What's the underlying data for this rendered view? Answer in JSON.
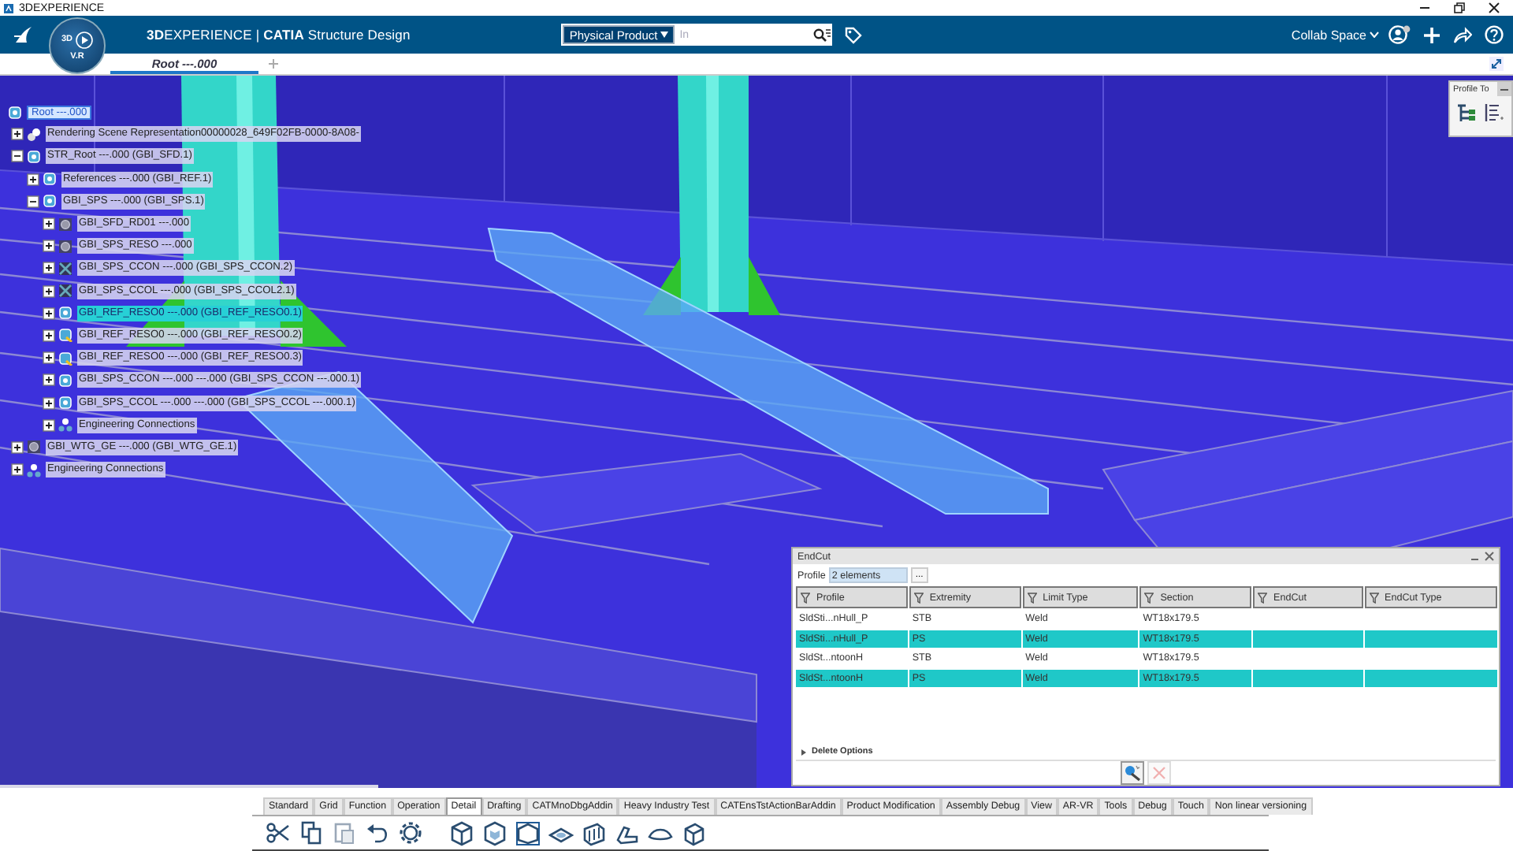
{
  "window": {
    "title": "3DEXPERIENCE"
  },
  "top_bar": {
    "brand": "**3D**EXPERIENCE | **CATIA** Structure Design",
    "compass": {
      "top": "3D",
      "bottom": "V.R"
    },
    "search": {
      "scope": "Physical Product",
      "placeholder": "In"
    },
    "collab_space": "Collab Space"
  },
  "tabs": [
    {
      "label": "Root ---.000",
      "selected": true
    }
  ],
  "tree": {
    "root": {
      "label": "Root ---.000",
      "selected": true
    },
    "items": [
      {
        "label": "Rendering Scene Representation00000028_649F02FB-0000-8A08-",
        "kind": "scene",
        "expanded": false,
        "selected": false
      },
      {
        "label": "STR_Root ---.000 (GBI_SFD.1)",
        "kind": "product",
        "expanded": true,
        "selected": false,
        "children": [
          {
            "label": "References ---.000 (GBI_REF.1)",
            "kind": "product",
            "expanded": false,
            "selected": false
          },
          {
            "label": "GBI_SPS ---.000 (GBI_SPS.1)",
            "kind": "product",
            "expanded": true,
            "selected": false,
            "children": [
              {
                "label": "GBI_SFD_RD01 ---.000",
                "kind": "shape",
                "expanded": false,
                "selected": false
              },
              {
                "label": "GBI_SPS_RESO ---.000",
                "kind": "shape",
                "expanded": false,
                "selected": false
              },
              {
                "label": "GBI_SPS_CCON ---.000 (GBI_SPS_CCON.2)",
                "kind": "frame",
                "expanded": false,
                "selected": false
              },
              {
                "label": "GBI_SPS_CCOL ---.000 (GBI_SPS_CCOL2.1)",
                "kind": "frame",
                "expanded": false,
                "selected": false
              },
              {
                "label": "GBI_REF_RESO0 ---.000 (GBI_REF_RESO0.1)",
                "kind": "product",
                "expanded": false,
                "selected": true
              },
              {
                "label": "GBI_REF_RESO0 ---.000 (GBI_REF_RESO0.2)",
                "kind": "reference",
                "expanded": false,
                "selected": false
              },
              {
                "label": "GBI_REF_RESO0 ---.000 (GBI_REF_RESO0.3)",
                "kind": "reference",
                "expanded": false,
                "selected": false
              },
              {
                "label": "GBI_SPS_CCON ---.000 ---.000 (GBI_SPS_CCON ---.000.1)",
                "kind": "product",
                "expanded": false,
                "selected": false
              },
              {
                "label": "GBI_SPS_CCOL ---.000 ---.000 (GBI_SPS_CCOL ---.000.1)",
                "kind": "product",
                "expanded": false,
                "selected": false
              },
              {
                "label": "Engineering Connections",
                "kind": "connections",
                "expanded": false,
                "selected": false
              }
            ]
          }
        ]
      },
      {
        "label": "GBI_WTG_GE ---.000 (GBI_WTG_GE.1)",
        "kind": "shape",
        "expanded": false,
        "selected": false
      },
      {
        "label": "Engineering Connections",
        "kind": "connections",
        "expanded": false,
        "selected": false
      }
    ]
  },
  "profile_toolbar": {
    "title": "Profile To"
  },
  "endcut_dialog": {
    "title": "EndCut",
    "profile_label": "Profile",
    "profile_value": "2 elements",
    "browse": "...",
    "columns": [
      "Profile",
      "Extremity",
      "Limit Type",
      "Section",
      "EndCut",
      "EndCut Type"
    ],
    "rows": [
      {
        "cells": [
          "SldSti...nHull_P",
          "STB",
          "Weld",
          "WT18x179.5"
        ],
        "selected": false
      },
      {
        "cells": [
          "SldSti...nHull_P",
          "PS",
          "Weld",
          "WT18x179.5"
        ],
        "selected": true
      },
      {
        "cells": [
          "SldSt...ntoonH",
          "STB",
          "Weld",
          "WT18x179.5"
        ],
        "selected": false
      },
      {
        "cells": [
          "SldSt...ntoonH",
          "PS",
          "Weld",
          "WT18x179.5"
        ],
        "selected": true
      }
    ],
    "section": {
      "label": "Delete Options",
      "expanded": false
    },
    "cancel_disabled": true
  },
  "action_bar": {
    "tabs": [
      {
        "label": "Standard",
        "selected": false
      },
      {
        "label": "Grid",
        "selected": false
      },
      {
        "label": "Function",
        "selected": false
      },
      {
        "label": "Operation",
        "selected": false
      },
      {
        "label": "Detail",
        "selected": true
      },
      {
        "label": "Drafting",
        "selected": false
      },
      {
        "label": "CATMnoDbgAddin",
        "selected": false
      },
      {
        "label": "Heavy Industry Test",
        "selected": false
      },
      {
        "label": "CATEnsTstActionBarAddin",
        "selected": false
      },
      {
        "label": "Product Modification",
        "selected": false
      },
      {
        "label": "Assembly Debug",
        "selected": false
      },
      {
        "label": "View",
        "selected": false
      },
      {
        "label": "AR-VR",
        "selected": false
      },
      {
        "label": "Tools",
        "selected": false
      },
      {
        "label": "Debug",
        "selected": false
      },
      {
        "label": "Touch",
        "selected": false
      },
      {
        "label": "Non linear versioning",
        "selected": false
      }
    ]
  }
}
